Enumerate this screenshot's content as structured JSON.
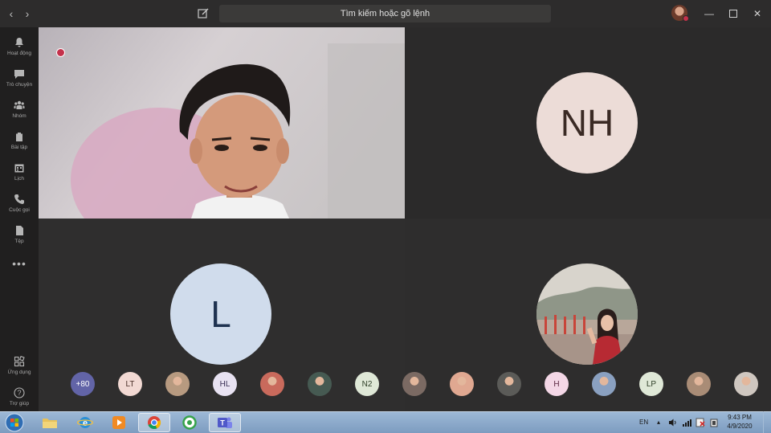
{
  "titlebar": {
    "search_placeholder": "Tìm kiếm hoặc gõ lệnh"
  },
  "sidebar": {
    "items": [
      {
        "label": "Hoạt động",
        "icon": "bell-icon"
      },
      {
        "label": "Trò chuyện",
        "icon": "chat-icon"
      },
      {
        "label": "Nhóm",
        "icon": "teams-icon"
      },
      {
        "label": "Bài tập",
        "icon": "backpack-icon"
      },
      {
        "label": "Lịch",
        "icon": "calendar-icon"
      },
      {
        "label": "Cuộc gọi",
        "icon": "phone-icon"
      },
      {
        "label": "Tệp",
        "icon": "file-icon"
      }
    ],
    "more": "•••",
    "apps_label": "Ứng dụng",
    "help_label": "Trợ giúp"
  },
  "stage": {
    "tiles": [
      {
        "initials": "NH",
        "bg": "#ecdcd7",
        "fg": "#3a2a24"
      },
      {
        "initials": "L",
        "bg": "#d0dcec",
        "fg": "#1e3250"
      }
    ]
  },
  "roster": [
    {
      "text": "+80",
      "bg": "#6264a7",
      "fg": "#ffffff",
      "kind": "overflow"
    },
    {
      "text": "LT",
      "bg": "#f2d9d3",
      "fg": "#4a2f28",
      "kind": "initials"
    },
    {
      "text": "",
      "bg": "#b79a80",
      "fg": "#ffffff",
      "kind": "photo"
    },
    {
      "text": "HL",
      "bg": "#e8e2f2",
      "fg": "#3a2f55",
      "kind": "initials"
    },
    {
      "text": "",
      "bg": "#c96a5c",
      "fg": "#ffffff",
      "kind": "photo"
    },
    {
      "text": "",
      "bg": "#465a52",
      "fg": "#ffffff",
      "kind": "photo"
    },
    {
      "text": "N2",
      "bg": "#dfe8d7",
      "fg": "#2f3f28",
      "kind": "initials"
    },
    {
      "text": "",
      "bg": "#7b6a63",
      "fg": "#ffffff",
      "kind": "photo"
    },
    {
      "text": "",
      "bg": "#e0a891",
      "fg": "#ffffff",
      "kind": "photo"
    },
    {
      "text": "",
      "bg": "#5b5b58",
      "fg": "#ffffff",
      "kind": "photo"
    },
    {
      "text": "H",
      "bg": "#f4d7e6",
      "fg": "#5a2640",
      "kind": "initials"
    },
    {
      "text": "",
      "bg": "#8aa0c0",
      "fg": "#ffffff",
      "kind": "photo"
    },
    {
      "text": "LP",
      "bg": "#dfe8d7",
      "fg": "#2f3f28",
      "kind": "initials"
    },
    {
      "text": "",
      "bg": "#a98c76",
      "fg": "#ffffff",
      "kind": "photo"
    },
    {
      "text": "",
      "bg": "#cfc7c0",
      "fg": "#ffffff",
      "kind": "photo"
    }
  ],
  "taskbar": {
    "language": "EN",
    "time": "9:43 PM",
    "date": "4/9/2020"
  }
}
